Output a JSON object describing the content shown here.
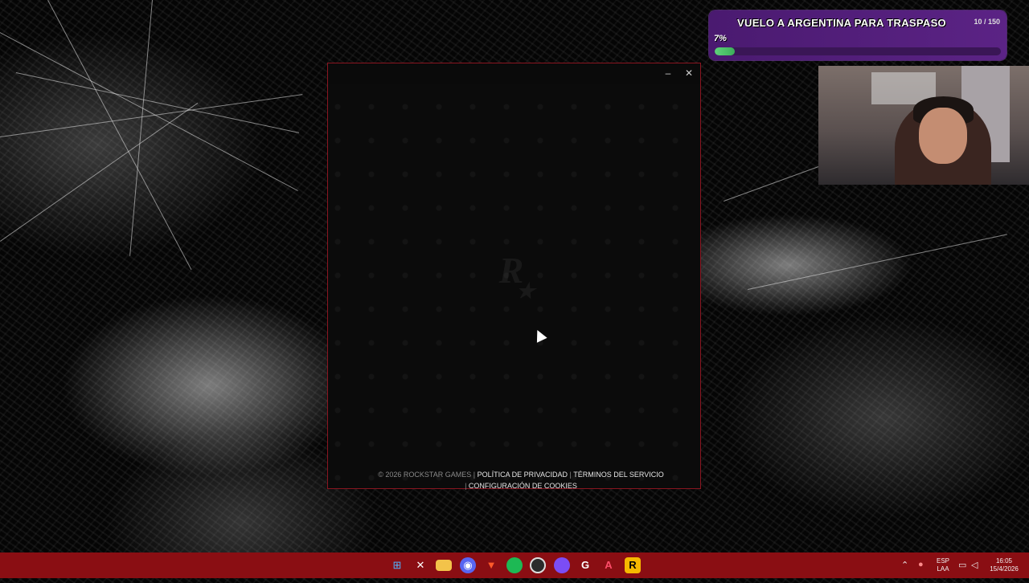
{
  "goal": {
    "title": "VUELO A ARGENTINA PARA TRASPASO",
    "count": "10 / 150",
    "percent_label": "7%",
    "progress": 0.07
  },
  "launcher": {
    "footer": {
      "copyright": "© 2026 ROCKSTAR GAMES",
      "sep": "|",
      "privacy": "POLÍTICA DE PRIVACIDAD",
      "terms": "TÉRMINOS DEL SERVICIO",
      "cookies": "CONFIGURACIÓN DE COOKIES"
    },
    "logo_text": "R"
  },
  "taskbar": {
    "apps": [
      {
        "name": "windows-start-icon"
      },
      {
        "name": "x-icon"
      },
      {
        "name": "file-explorer-icon"
      },
      {
        "name": "discord-icon"
      },
      {
        "name": "brave-icon"
      },
      {
        "name": "spotify-icon"
      },
      {
        "name": "obs-icon"
      },
      {
        "name": "circle-app-icon"
      },
      {
        "name": "chrome-icon"
      },
      {
        "name": "adobe-icon"
      },
      {
        "name": "rockstar-launcher-icon"
      }
    ],
    "lang_top": "ESP",
    "lang_bottom": "LAA",
    "time": "16:05",
    "date": "15/4/2026"
  },
  "colors": {
    "taskbar": "#8a0e13",
    "goal_bg": "#5b2385",
    "goal_fill": "#4cc06a",
    "window_border": "#8a1520"
  }
}
